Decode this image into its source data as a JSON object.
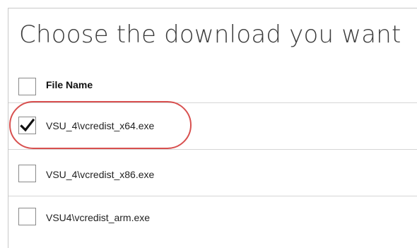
{
  "page": {
    "title": "Choose the download you want"
  },
  "table": {
    "header": {
      "select_all_checked": false,
      "column_label": "File Name"
    },
    "rows": [
      {
        "file_name": "VSU_4\\vcredist_x64.exe",
        "checked": true
      },
      {
        "file_name": "VSU_4\\vcredist_x86.exe",
        "checked": false
      },
      {
        "file_name": "VSU4\\vcredist_arm.exe",
        "checked": false
      }
    ]
  },
  "colors": {
    "highlight": "#d8504f",
    "border": "#8a8a8a",
    "separator": "#d6d6d6"
  },
  "icons": {
    "checkmark": "checkmark-icon"
  }
}
